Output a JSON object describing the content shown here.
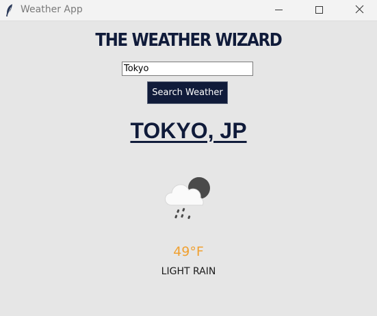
{
  "window": {
    "title": "Weather App",
    "app_icon": "feather-icon"
  },
  "header": {
    "title": "THE WEATHER WIZARD"
  },
  "search": {
    "value": "Tokyo",
    "button_label": "Search Weather"
  },
  "result": {
    "city": "TOKYO, JP",
    "icon": "cloud-rain-night-icon",
    "temperature": "49°F",
    "condition": "LIGHT RAIN"
  },
  "colors": {
    "background": "#e6e6e6",
    "brand_navy": "#101b3a",
    "temperature": "#f0a030"
  }
}
